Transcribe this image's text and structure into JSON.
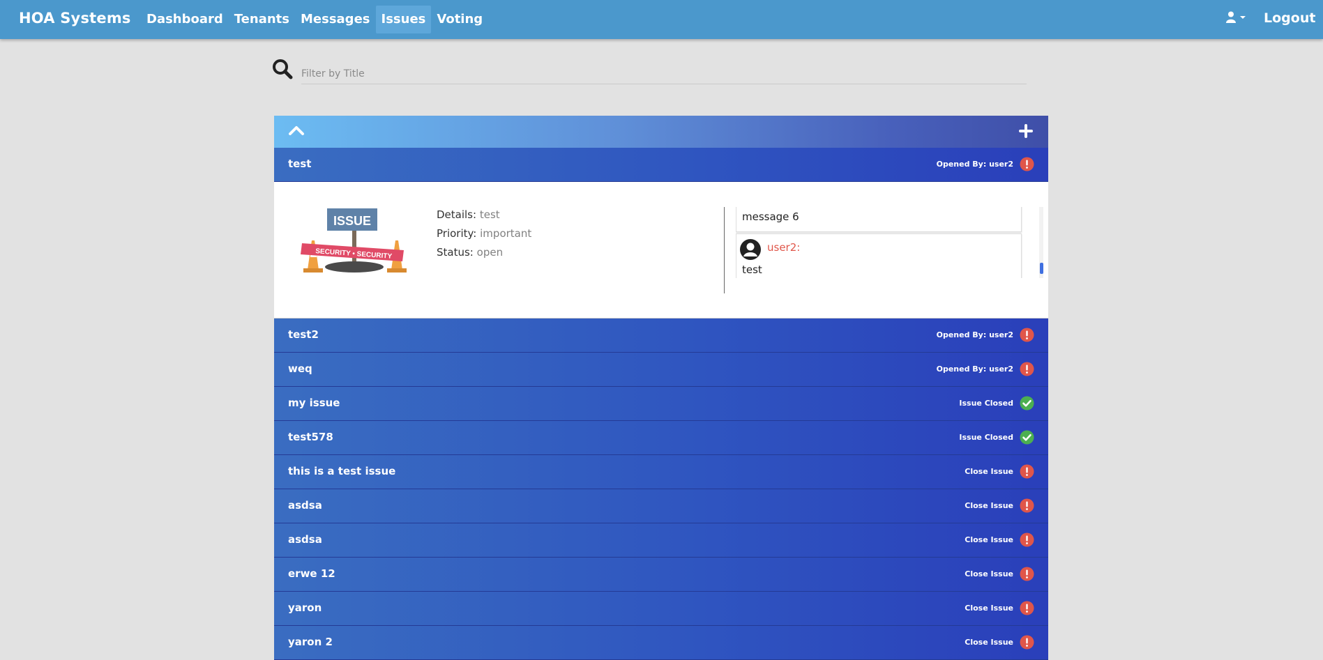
{
  "navbar": {
    "brand": "HOA Systems",
    "links": [
      {
        "label": "Dashboard",
        "active": false
      },
      {
        "label": "Tenants",
        "active": false
      },
      {
        "label": "Messages",
        "active": false
      },
      {
        "label": "Issues",
        "active": true
      },
      {
        "label": "Voting",
        "active": false
      }
    ],
    "user_icon": "user-icon",
    "logout_label": "Logout"
  },
  "search": {
    "placeholder": "Filter by Title",
    "icon": "search-icon"
  },
  "panel": {
    "collapse_icon": "chevron-up-icon",
    "add_icon": "plus-icon",
    "expanded_issue": {
      "title": "test",
      "status_text": "Opened By: user2",
      "status_icon": "exclamation-icon",
      "image_labels": {
        "sign": "ISSUE",
        "tape": "SECURITY • SECURITY"
      },
      "details_label": "Details:",
      "details_value": "test",
      "priority_label": "Priority:",
      "priority_value": "important",
      "status_label": "Status:",
      "status_value": "open",
      "messages": [
        {
          "user": "",
          "text": "message 6"
        },
        {
          "user": "user2:",
          "text": "test"
        }
      ]
    },
    "issues": [
      {
        "title": "test2",
        "status_text": "Opened By: user2",
        "icon": "exclamation-icon"
      },
      {
        "title": "weq",
        "status_text": "Opened By: user2",
        "icon": "exclamation-icon"
      },
      {
        "title": "my issue",
        "status_text": "Issue Closed",
        "icon": "check-icon"
      },
      {
        "title": "test578",
        "status_text": "Issue Closed",
        "icon": "check-icon"
      },
      {
        "title": "this is a test issue",
        "status_text": "Close Issue",
        "icon": "exclamation-icon"
      },
      {
        "title": "asdsa",
        "status_text": "Close Issue",
        "icon": "exclamation-icon"
      },
      {
        "title": "asdsa",
        "status_text": "Close Issue",
        "icon": "exclamation-icon"
      },
      {
        "title": "erwe 12",
        "status_text": "Close Issue",
        "icon": "exclamation-icon"
      },
      {
        "title": "yaron",
        "status_text": "Close Issue",
        "icon": "exclamation-icon"
      },
      {
        "title": "yaron 2",
        "status_text": "Close Issue",
        "icon": "exclamation-icon"
      }
    ]
  },
  "colors": {
    "navbar": "#4b98cc",
    "row": "#2f55c0",
    "open_icon": "#e0564a",
    "closed_icon": "#4caf50",
    "message_user": "#e0564a"
  }
}
